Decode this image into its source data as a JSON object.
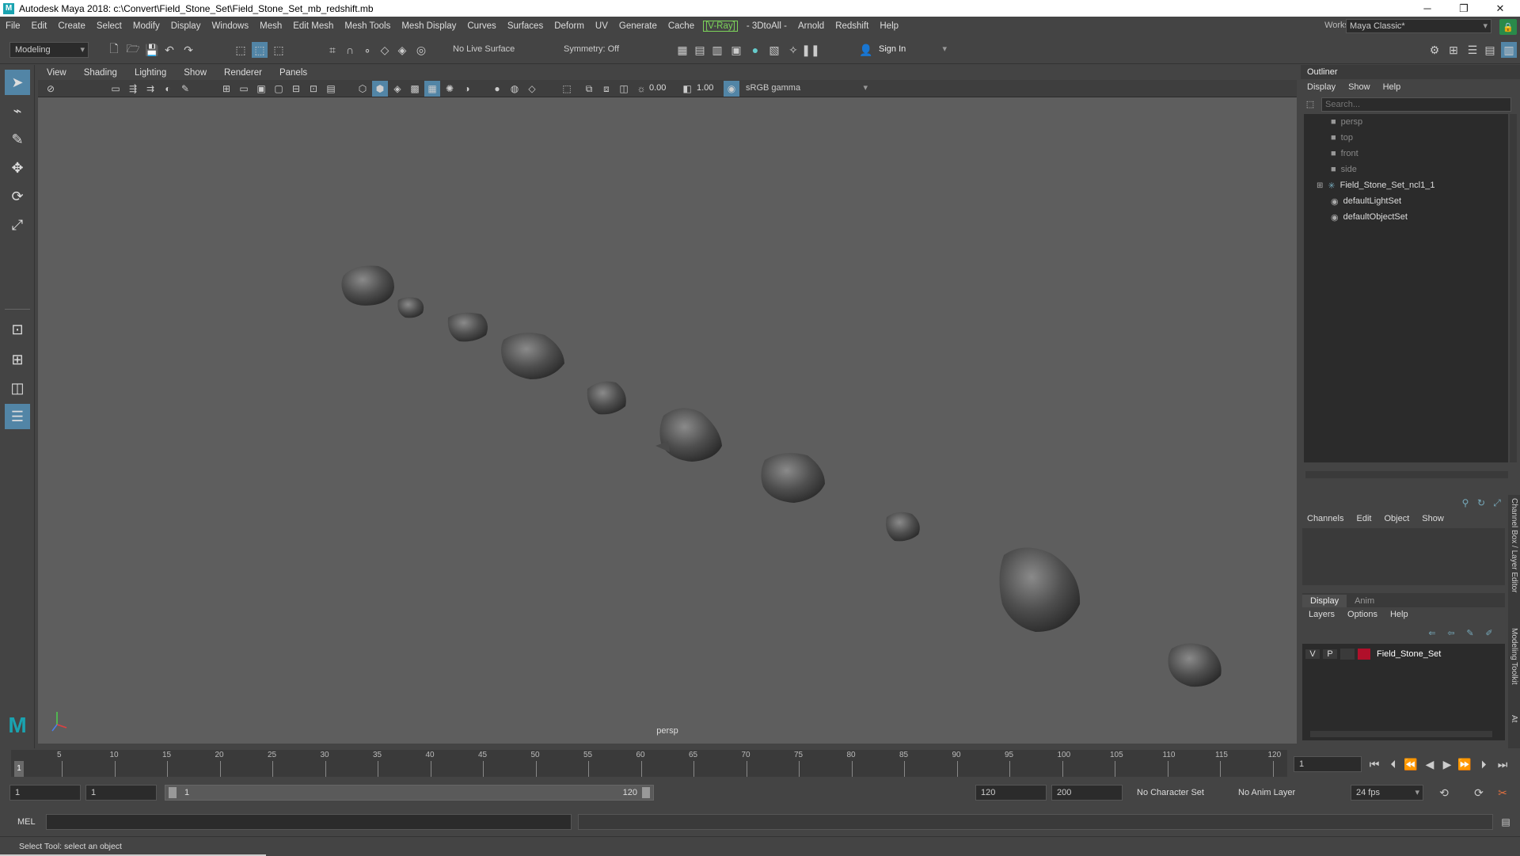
{
  "title": "Autodesk Maya 2018: c:\\Convert\\Field_Stone_Set\\Field_Stone_Set_mb_redshift.mb",
  "menubar": [
    "File",
    "Edit",
    "Create",
    "Select",
    "Modify",
    "Display",
    "Windows",
    "Mesh",
    "Edit Mesh",
    "Mesh Tools",
    "Mesh Display",
    "Curves",
    "Surfaces",
    "Deform",
    "UV",
    "Generate",
    "Cache",
    "[V-Ray]",
    "- 3DtoAll -",
    "Arnold",
    "Redshift",
    "Help"
  ],
  "workspace": {
    "label": "Workspace :",
    "value": "Maya Classic*"
  },
  "statusline": {
    "mode": "Modeling",
    "live_surface": "No Live Surface",
    "symmetry": "Symmetry: Off",
    "sign_in": "Sign In"
  },
  "viewport": {
    "menu": [
      "View",
      "Shading",
      "Lighting",
      "Show",
      "Renderer",
      "Panels"
    ],
    "exposure": "0.00",
    "gamma": "1.00",
    "color_space": "sRGB gamma",
    "camera_label": "persp",
    "background": "#5e5e5e"
  },
  "outliner": {
    "title": "Outliner",
    "menu": [
      "Display",
      "Show",
      "Help"
    ],
    "search_placeholder": "Search...",
    "items": [
      {
        "label": "persp",
        "icon": "camera-icon",
        "dim": true
      },
      {
        "label": "top",
        "icon": "camera-icon",
        "dim": true
      },
      {
        "label": "front",
        "icon": "camera-icon",
        "dim": true
      },
      {
        "label": "side",
        "icon": "camera-icon",
        "dim": true
      },
      {
        "label": "Field_Stone_Set_ncl1_1",
        "icon": "group-icon",
        "dim": false
      },
      {
        "label": "defaultLightSet",
        "icon": "set-icon",
        "dim": false
      },
      {
        "label": "defaultObjectSet",
        "icon": "set-icon",
        "dim": false
      }
    ]
  },
  "channelbox": {
    "menu": [
      "Channels",
      "Edit",
      "Object",
      "Show"
    ],
    "tabs": [
      "Display",
      "Anim"
    ],
    "layer_menu": [
      "Layers",
      "Options",
      "Help"
    ],
    "layer": {
      "v": "V",
      "p": "P",
      "name": "Field_Stone_Set",
      "color": "#b0102a"
    },
    "side_tabs": [
      "Channel Box / Layer Editor",
      "Modeling Toolkit",
      "At"
    ]
  },
  "timeslider": {
    "ticks": [
      "5",
      "10",
      "15",
      "20",
      "25",
      "30",
      "35",
      "40",
      "45",
      "50",
      "55",
      "60",
      "65",
      "70",
      "75",
      "80",
      "85",
      "90",
      "95",
      "100",
      "105",
      "110",
      "115",
      "120"
    ],
    "current_frame_marker": "1",
    "current_frame": "1"
  },
  "range": {
    "start": "1",
    "playback_start": "1",
    "slider_start": "1",
    "slider_end": "120",
    "playback_end": "120",
    "end": "200",
    "character_set": "No Character Set",
    "anim_layer": "No Anim Layer",
    "fps": "24 fps"
  },
  "mel": {
    "label": "MEL"
  },
  "helpline": "Select Tool: select an object"
}
